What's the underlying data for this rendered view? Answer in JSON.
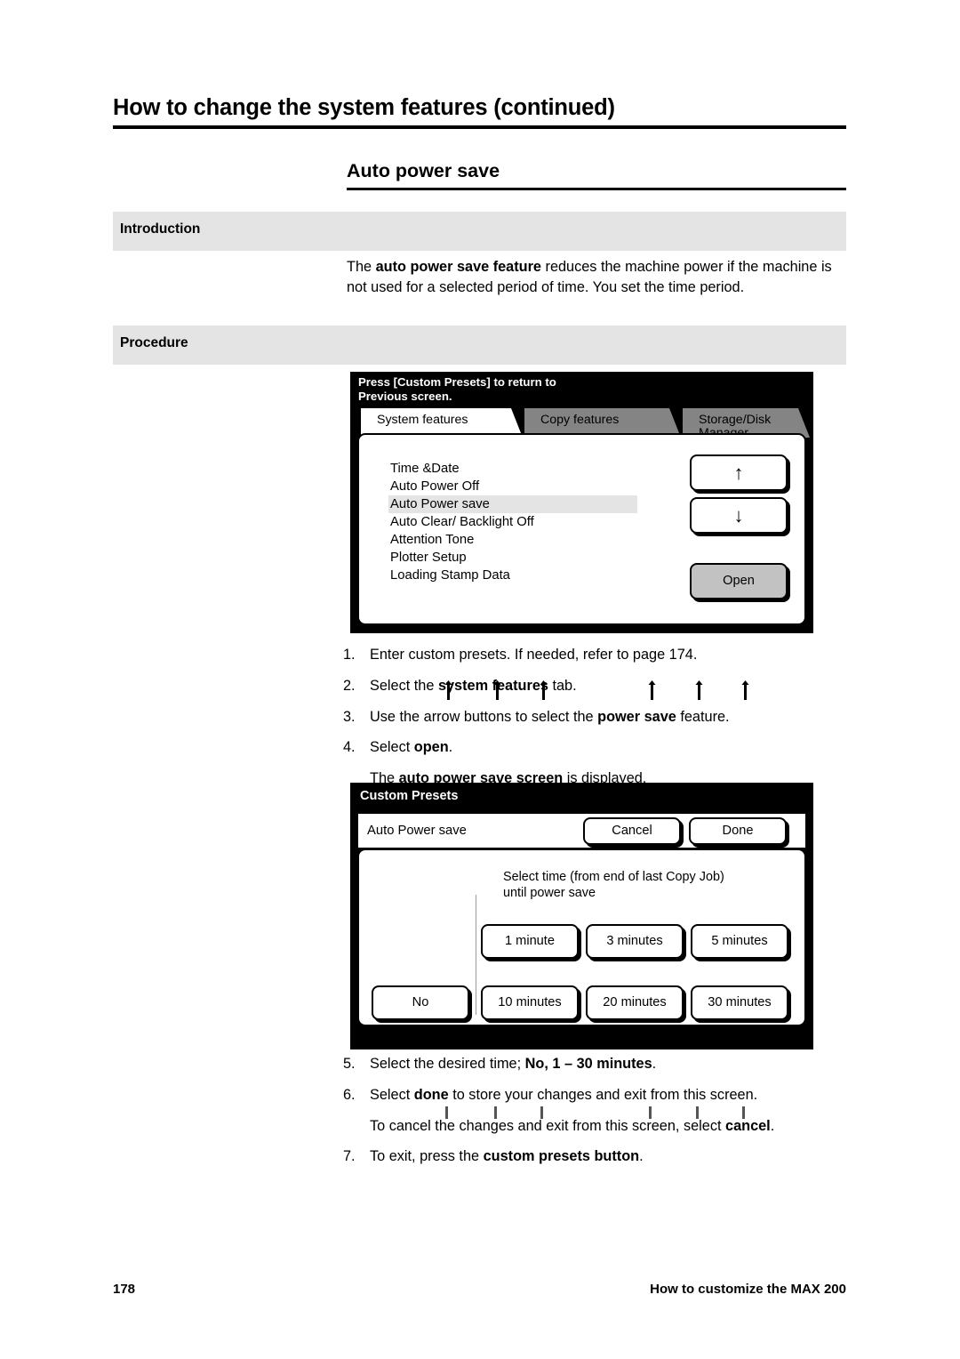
{
  "header": {
    "title": "How to change the system features (continued)"
  },
  "section": {
    "title": "Auto power save"
  },
  "bands": {
    "introduction": "Introduction",
    "procedure": "Procedure"
  },
  "intro": {
    "text_1": "The ",
    "bold_1": "auto power save feature",
    "text_2": " reduces the machine power if the machine is not used for a selected period of time.  You set the time period."
  },
  "screen_one": {
    "banner": "Press [Custom Presets] to return to\nPrevious screen.",
    "tabs": [
      {
        "label": "System features",
        "active": true
      },
      {
        "label": "Copy features",
        "active": false
      },
      {
        "label": "Storage/Disk\nManager",
        "active": false
      }
    ],
    "features": [
      {
        "label": "Time &Date",
        "selected": false
      },
      {
        "label": "Auto Power Off",
        "selected": false
      },
      {
        "label": "Auto Power save",
        "selected": true
      },
      {
        "label": "Auto Clear/ Backlight Off",
        "selected": false
      },
      {
        "label": "Attention Tone",
        "selected": false
      },
      {
        "label": "Plotter Setup",
        "selected": false
      },
      {
        "label": "Loading Stamp Data",
        "selected": false
      }
    ],
    "buttons": {
      "up_icon": "up-arrow-icon",
      "up_glyph": "↑",
      "down_icon": "down-arrow-icon",
      "down_glyph": "↓",
      "open_label": "Open"
    }
  },
  "steps_a": [
    {
      "num": "1.",
      "text_1": "Enter custom presets.  If needed, refer to page 174.",
      "bold": "",
      "text_2": ""
    },
    {
      "num": "2.",
      "text_1": "Select the ",
      "bold": "system features",
      "text_2": " tab."
    },
    {
      "num": "3.",
      "text_1": "Use the arrow buttons to select the ",
      "bold": "power save",
      "text_2": " feature."
    },
    {
      "num": "4.",
      "text_1": "Select ",
      "bold": "open",
      "text_2": "."
    }
  ],
  "steps_a_sub": {
    "text_1": "The ",
    "bold": "auto power save screen",
    "text_2": " is displayed."
  },
  "screen_two": {
    "title": "Custom Presets",
    "subheader_label": "Auto Power save",
    "cancel_label": "Cancel",
    "done_label": "Done",
    "prompt": "Select time (from end of last Copy Job)\nuntil power save",
    "time_buttons": [
      {
        "id": "1min",
        "label": "1 minute"
      },
      {
        "id": "3min",
        "label": "3 minutes"
      },
      {
        "id": "5min",
        "label": "5 minutes"
      },
      {
        "id": "no",
        "label": "No"
      },
      {
        "id": "10min",
        "label": "10 minutes"
      },
      {
        "id": "20min",
        "label": "20 minutes"
      },
      {
        "id": "30min",
        "label": "30 minutes"
      }
    ]
  },
  "steps_b": [
    {
      "num": "5.",
      "text_1": "Select the desired time; ",
      "bold": "No, 1 – 30 minutes",
      "text_2": "."
    },
    {
      "num": "6.",
      "text_1": "Select ",
      "bold": "done",
      "text_2": " to store your changes and exit from this screen."
    }
  ],
  "steps_b_sub": {
    "text_1": "To cancel the changes and exit from this screen, select ",
    "bold": "cancel",
    "text_2": "."
  },
  "steps_b_last": {
    "num": "7.",
    "text_1": "To exit, press the ",
    "bold": "custom presets button",
    "text_2": "."
  },
  "footer": {
    "page_number": "178",
    "book_title": "How to customize the MAX 200"
  },
  "colors": {
    "band_gray": "#e4e4e4",
    "tab_inactive_gray": "#848484",
    "button_fill_gray": "#c2c2c2",
    "screen_black": "#000000"
  }
}
